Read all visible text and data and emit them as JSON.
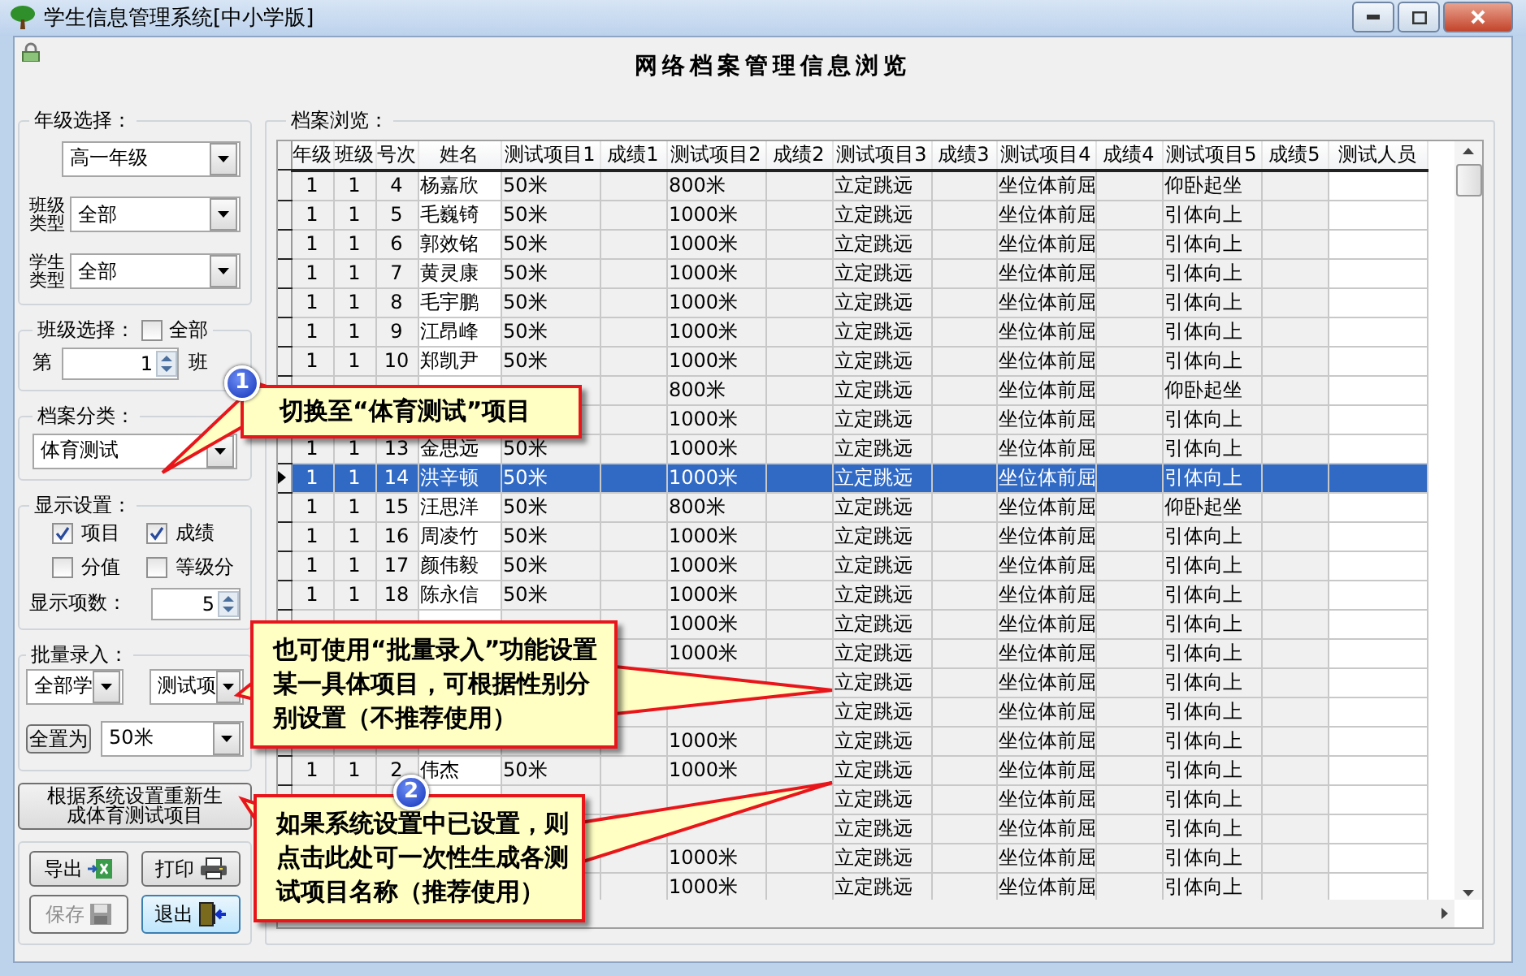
{
  "window": {
    "title": "学生信息管理系统[中小学版]"
  },
  "header": {
    "title": "网络档案管理信息浏览"
  },
  "grade": {
    "legend": "年级选择：",
    "value": "高一年级"
  },
  "class_type": {
    "label": "班级类型",
    "value": "全部"
  },
  "student_type": {
    "label": "学生类型",
    "value": "全部"
  },
  "class_select": {
    "legend": "班级选择：",
    "all_label": "全部",
    "all_checked": false,
    "prefix": "第",
    "value": "1",
    "suffix": "班"
  },
  "category": {
    "legend": "档案分类：",
    "value": "体育测试"
  },
  "display": {
    "legend": "显示设置：",
    "options": [
      {
        "label": "项目",
        "checked": true
      },
      {
        "label": "成绩",
        "checked": true
      },
      {
        "label": "分值",
        "checked": false
      },
      {
        "label": "等级分",
        "checked": false
      }
    ],
    "count_label": "显示项数：",
    "count": "5"
  },
  "batch": {
    "legend": "批量录入：",
    "scope": "全部学",
    "item": "测试项",
    "set_button": "全置为",
    "set_value": "50米"
  },
  "regenerate_button": "根据系统设置重新生成体育测试项目",
  "actions": [
    {
      "label": "导出",
      "kind": "export",
      "disabled": false,
      "focused": false
    },
    {
      "label": "打印",
      "kind": "print",
      "disabled": false,
      "focused": false
    },
    {
      "label": "保存",
      "kind": "save",
      "disabled": true,
      "focused": false
    },
    {
      "label": "退出",
      "kind": "exit",
      "disabled": false,
      "focused": true
    }
  ],
  "browser": {
    "legend": "档案浏览：",
    "columns": [
      "年级",
      "班级",
      "号次",
      "姓名",
      "测试项目1",
      "成绩1",
      "测试项目2",
      "成绩2",
      "测试项目3",
      "成绩3",
      "测试项目4",
      "成绩4",
      "测试项目5",
      "成绩5",
      "测试人员"
    ],
    "rows": [
      {
        "selected": false,
        "cells": [
          "1",
          "1",
          "4",
          "杨嘉欣",
          "50米",
          null,
          "800米",
          null,
          "立定跳远",
          null,
          "坐位体前屈",
          null,
          "仰卧起坐",
          null,
          null
        ]
      },
      {
        "selected": false,
        "cells": [
          "1",
          "1",
          "5",
          "毛巍锜",
          "50米",
          null,
          "1000米",
          null,
          "立定跳远",
          null,
          "坐位体前屈",
          null,
          "引体向上",
          null,
          null
        ]
      },
      {
        "selected": false,
        "cells": [
          "1",
          "1",
          "6",
          "郭效铭",
          "50米",
          null,
          "1000米",
          null,
          "立定跳远",
          null,
          "坐位体前屈",
          null,
          "引体向上",
          null,
          null
        ]
      },
      {
        "selected": false,
        "cells": [
          "1",
          "1",
          "7",
          "黄灵康",
          "50米",
          null,
          "1000米",
          null,
          "立定跳远",
          null,
          "坐位体前屈",
          null,
          "引体向上",
          null,
          null
        ]
      },
      {
        "selected": false,
        "cells": [
          "1",
          "1",
          "8",
          "毛宇鹏",
          "50米",
          null,
          "1000米",
          null,
          "立定跳远",
          null,
          "坐位体前屈",
          null,
          "引体向上",
          null,
          null
        ]
      },
      {
        "selected": false,
        "cells": [
          "1",
          "1",
          "9",
          "江昂峰",
          "50米",
          null,
          "1000米",
          null,
          "立定跳远",
          null,
          "坐位体前屈",
          null,
          "引体向上",
          null,
          null
        ]
      },
      {
        "selected": false,
        "cells": [
          "1",
          "1",
          "10",
          "郑凯尹",
          "50米",
          null,
          "1000米",
          null,
          "立定跳远",
          null,
          "坐位体前屈",
          null,
          "引体向上",
          null,
          null
        ]
      },
      {
        "selected": false,
        "cells": [
          null,
          null,
          null,
          null,
          null,
          null,
          "800米",
          null,
          "立定跳远",
          null,
          "坐位体前屈",
          null,
          "仰卧起坐",
          null,
          null
        ]
      },
      {
        "selected": false,
        "cells": [
          null,
          null,
          null,
          null,
          null,
          null,
          "1000米",
          null,
          "立定跳远",
          null,
          "坐位体前屈",
          null,
          "引体向上",
          null,
          null
        ]
      },
      {
        "selected": false,
        "cells": [
          "1",
          "1",
          "13",
          "金思远",
          "50米",
          null,
          "1000米",
          null,
          "立定跳远",
          null,
          "坐位体前屈",
          null,
          "引体向上",
          null,
          null
        ]
      },
      {
        "selected": true,
        "cells": [
          "1",
          "1",
          "14",
          "洪辛顿",
          "50米",
          null,
          "1000米",
          null,
          "立定跳远",
          null,
          "坐位体前屈",
          null,
          "引体向上",
          null,
          null
        ]
      },
      {
        "selected": false,
        "cells": [
          "1",
          "1",
          "15",
          "汪思洋",
          "50米",
          null,
          "800米",
          null,
          "立定跳远",
          null,
          "坐位体前屈",
          null,
          "仰卧起坐",
          null,
          null
        ]
      },
      {
        "selected": false,
        "cells": [
          "1",
          "1",
          "16",
          "周凌竹",
          "50米",
          null,
          "1000米",
          null,
          "立定跳远",
          null,
          "坐位体前屈",
          null,
          "引体向上",
          null,
          null
        ]
      },
      {
        "selected": false,
        "cells": [
          "1",
          "1",
          "17",
          "颜伟毅",
          "50米",
          null,
          "1000米",
          null,
          "立定跳远",
          null,
          "坐位体前屈",
          null,
          "引体向上",
          null,
          null
        ]
      },
      {
        "selected": false,
        "cells": [
          "1",
          "1",
          "18",
          "陈永信",
          "50米",
          null,
          "1000米",
          null,
          "立定跳远",
          null,
          "坐位体前屈",
          null,
          "引体向上",
          null,
          null
        ]
      },
      {
        "selected": false,
        "cells": [
          null,
          null,
          null,
          null,
          null,
          null,
          "1000米",
          null,
          "立定跳远",
          null,
          "坐位体前屈",
          null,
          "引体向上",
          null,
          null
        ]
      },
      {
        "selected": false,
        "cells": [
          null,
          null,
          null,
          null,
          null,
          null,
          "1000米",
          null,
          "立定跳远",
          null,
          "坐位体前屈",
          null,
          "引体向上",
          null,
          null
        ]
      },
      {
        "selected": false,
        "cells": [
          null,
          null,
          null,
          null,
          null,
          null,
          null,
          null,
          "立定跳远",
          null,
          "坐位体前屈",
          null,
          "引体向上",
          null,
          null
        ]
      },
      {
        "selected": false,
        "cells": [
          null,
          null,
          null,
          null,
          null,
          null,
          null,
          null,
          "立定跳远",
          null,
          "坐位体前屈",
          null,
          "引体向上",
          null,
          null
        ]
      },
      {
        "selected": false,
        "cells": [
          null,
          null,
          null,
          null,
          null,
          null,
          "1000米",
          null,
          "立定跳远",
          null,
          "坐位体前屈",
          null,
          "引体向上",
          null,
          null
        ]
      },
      {
        "selected": false,
        "cells": [
          "1",
          "1",
          "2",
          "伟杰",
          "50米",
          null,
          "1000米",
          null,
          "立定跳远",
          null,
          "坐位体前屈",
          null,
          "引体向上",
          null,
          null
        ]
      },
      {
        "selected": false,
        "cells": [
          null,
          null,
          null,
          null,
          null,
          null,
          null,
          null,
          "立定跳远",
          null,
          "坐位体前屈",
          null,
          "引体向上",
          null,
          null
        ]
      },
      {
        "selected": false,
        "cells": [
          null,
          null,
          null,
          null,
          null,
          null,
          null,
          null,
          "立定跳远",
          null,
          "坐位体前屈",
          null,
          "引体向上",
          null,
          null
        ]
      },
      {
        "selected": false,
        "cells": [
          null,
          null,
          null,
          null,
          null,
          null,
          "1000米",
          null,
          "立定跳远",
          null,
          "坐位体前屈",
          null,
          "引体向上",
          null,
          null
        ]
      },
      {
        "selected": false,
        "cells": [
          null,
          null,
          null,
          null,
          null,
          null,
          "1000米",
          null,
          "立定跳远",
          null,
          "坐位体前屈",
          null,
          "引体向上",
          null,
          null
        ]
      }
    ]
  },
  "callouts": [
    {
      "badge": "1",
      "text": "切换至“体育测试”项目"
    },
    {
      "text": "也可使用“批量录入”功能设置某一具体项目，可根据性别分别设置（不推荐使用）"
    },
    {
      "badge": "2",
      "text": "如果系统设置中已设置，则点击此处可一次性生成各测试项目名称（推荐使用）"
    }
  ]
}
